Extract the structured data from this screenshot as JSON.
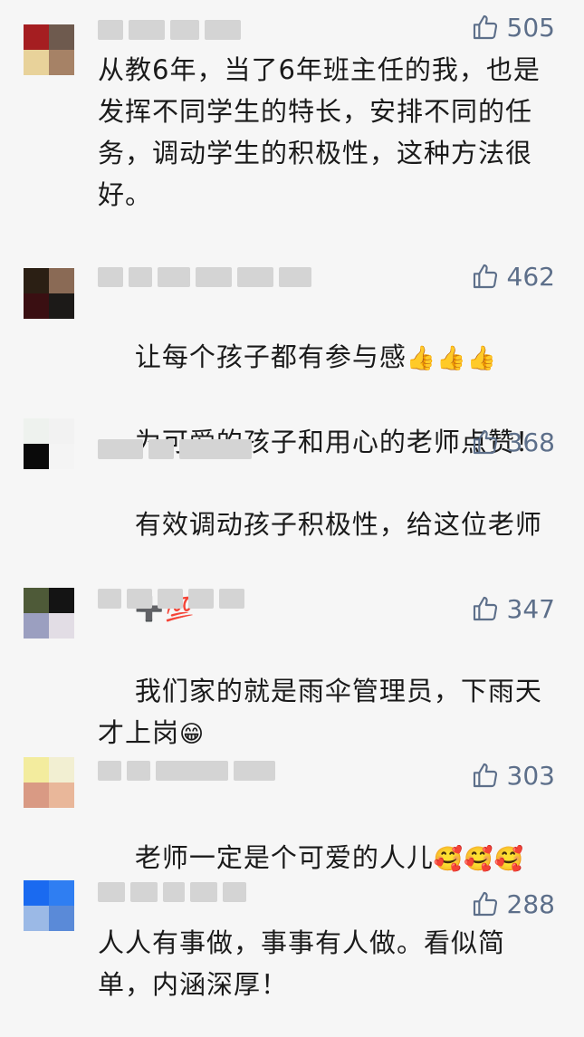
{
  "comments": [
    {
      "likes": "505",
      "text": "从教6年，当了6年班主任的我，也是发挥不同学生的特长，安排不同的任务，调动学生的积极性，这种方法很好。",
      "avatar_colors": [
        "#a51e21",
        "#6e5a4e",
        "#e8d29a",
        "#a68266"
      ]
    },
    {
      "likes": "462",
      "text": "让每个孩子都有参与感",
      "emojis": "👍👍👍",
      "text2": "为可爱的孩子和用心的老师点赞！",
      "avatar_colors": [
        "#2b1f14",
        "#8a6a55",
        "#3a0f12",
        "#1c1a18"
      ]
    },
    {
      "likes": "368",
      "text": "有效调动孩子积极性，给这位老师",
      "emojis": "➕💯",
      "avatar_colors": [
        "#eef2ee",
        "#f2f2f2",
        "#0a0a0a",
        "#f4f4f4"
      ]
    },
    {
      "likes": "347",
      "text": "我们家的就是雨伞管理员，下雨天才上岗",
      "emojis": "😁",
      "avatar_colors": [
        "#4e5a38",
        "#141414",
        "#9b9fc0",
        "#e2dde5"
      ]
    },
    {
      "likes": "303",
      "text": "老师一定是个可爱的人儿",
      "emojis": "🥰🥰🥰",
      "avatar_colors": [
        "#f3ec9e",
        "#f2efd2",
        "#d99a84",
        "#e9b79a"
      ]
    },
    {
      "likes": "288",
      "text": "人人有事做，事事有人做。看似简单，内涵深厚！",
      "avatar_colors": [
        "#1a6af0",
        "#2f7ef2",
        "#9bb9e6",
        "#5a8ad8"
      ]
    }
  ],
  "icons": {
    "like": "thumbs-up-icon"
  },
  "colors": {
    "likes_text": "#5d6f8a",
    "body_text": "#1a1a1a",
    "background": "#f6f6f6"
  }
}
